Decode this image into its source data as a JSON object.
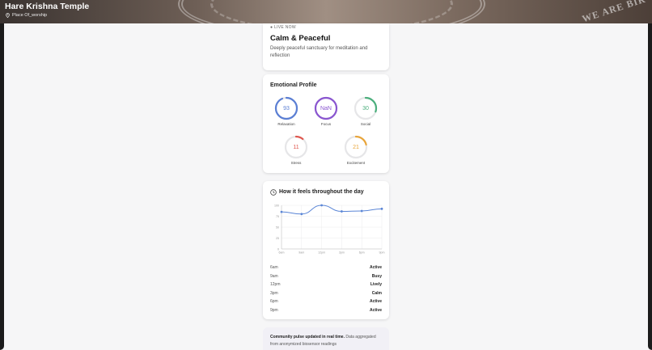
{
  "header": {
    "title": "Hare Krishna Temple",
    "category": "Place Of_worship",
    "banner_text": "WE ARE BIR"
  },
  "status": {
    "live_label": "LIVE NOW",
    "mood": "Calm & Peaceful",
    "description": "Deeply peaceful sanctuary for meditation and reflection"
  },
  "emotional_profile": {
    "title": "Emotional Profile",
    "metrics": [
      {
        "label": "Relaxation",
        "value": "93",
        "fraction": 0.93,
        "color": "#5b7fd4"
      },
      {
        "label": "Focus",
        "value": "NaN",
        "fraction": 1.0,
        "color": "#8a56d0"
      },
      {
        "label": "Social",
        "value": "30",
        "fraction": 0.3,
        "color": "#4caf7d"
      },
      {
        "label": "Stress",
        "value": "11",
        "fraction": 0.11,
        "color": "#e0584f"
      },
      {
        "label": "Excitement",
        "value": "21",
        "fraction": 0.21,
        "color": "#e9a53a"
      }
    ]
  },
  "daytime": {
    "title": "How it feels throughout the day",
    "timeline": [
      {
        "time": "6am",
        "state": "Active"
      },
      {
        "time": "9am",
        "state": "Busy"
      },
      {
        "time": "12pm",
        "state": "Lively"
      },
      {
        "time": "3pm",
        "state": "Calm"
      },
      {
        "time": "6pm",
        "state": "Active"
      },
      {
        "time": "9pm",
        "state": "Active"
      }
    ]
  },
  "chart_data": {
    "type": "line",
    "categories": [
      "6am",
      "9am",
      "12pm",
      "3pm",
      "6pm",
      "9pm"
    ],
    "series": [
      {
        "values": [
          85,
          80,
          100,
          86,
          87,
          92
        ]
      }
    ],
    "yticks": [
      "0",
      "25",
      "50",
      "75",
      "100"
    ],
    "ylim": [
      0,
      100
    ],
    "color": "#5b86d6",
    "grid": true
  },
  "footer": {
    "pulse_bold": "Community pulse updated in real time.",
    "pulse_text": "Data aggregated from anonymized biosensor readings"
  }
}
